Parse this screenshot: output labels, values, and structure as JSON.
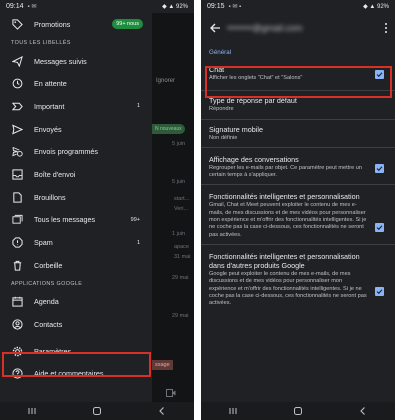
{
  "left": {
    "status": {
      "time": "09:14",
      "right": "92%"
    },
    "drawer": {
      "promotions": {
        "label": "Promotions",
        "badge": "99+ nous"
      },
      "labels_header": "TOUS LES LIBELLÉS",
      "items": [
        {
          "name": "messages-suivis",
          "icon": "send-schedule-icon",
          "label": "Messages suivis",
          "count": ""
        },
        {
          "name": "en-attente",
          "icon": "clock-icon",
          "label": "En attente",
          "count": ""
        },
        {
          "name": "important",
          "icon": "important-icon",
          "label": "Important",
          "count": "1"
        },
        {
          "name": "envoyes",
          "icon": "send-icon",
          "label": "Envoyés",
          "count": ""
        },
        {
          "name": "envois-programmes",
          "icon": "schedule-send-icon",
          "label": "Envois programmés",
          "count": ""
        },
        {
          "name": "boite-envoi",
          "icon": "outbox-icon",
          "label": "Boîte d'envoi",
          "count": ""
        },
        {
          "name": "brouillons",
          "icon": "draft-icon",
          "label": "Brouillons",
          "count": ""
        },
        {
          "name": "tous-les-messages",
          "icon": "all-mail-icon",
          "label": "Tous les messages",
          "count": "99+"
        },
        {
          "name": "spam",
          "icon": "spam-icon",
          "label": "Spam",
          "count": "1"
        },
        {
          "name": "corbeille",
          "icon": "trash-icon",
          "label": "Corbeille",
          "count": ""
        }
      ],
      "apps_header": "APPLICATIONS GOOGLE",
      "apps": [
        {
          "name": "agenda",
          "icon": "calendar-icon",
          "label": "Agenda"
        },
        {
          "name": "contacts",
          "icon": "contacts-icon",
          "label": "Contacts"
        }
      ],
      "settings": {
        "label": "Paramètres"
      },
      "help": {
        "label": "Aide et commentaires"
      }
    },
    "strip": {
      "ignorer": "Ignorer",
      "chip": "N nouveaux",
      "dates": [
        "5 juin",
        "5 juin",
        "start...",
        "Veri...",
        "1 juin",
        "apace",
        "31 mai",
        "29 mai",
        "29 mai"
      ],
      "message_btn": "ssage"
    }
  },
  "right": {
    "status": {
      "time": "09:15",
      "right": "92%"
    },
    "header": {
      "account": "••••••••@gmail.com"
    },
    "general_header": "Général",
    "settings": [
      {
        "name": "chat",
        "title": "Chat",
        "desc": "Afficher les onglets \"Chat\" et \"Salons\"",
        "checked": true
      },
      {
        "name": "type-reponse",
        "title": "Type de réponse par défaut",
        "desc": "Répondre",
        "checked": false
      },
      {
        "name": "signature",
        "title": "Signature mobile",
        "desc": "Non définie",
        "checked": false
      },
      {
        "name": "affichage-conversations",
        "title": "Affichage des conversations",
        "desc": "Regrouper les e-mails par objet. Ce paramètre peut mettre un certain temps à s'appliquer.",
        "checked": true
      },
      {
        "name": "fonctionnalites",
        "title": "Fonctionnalités intelligentes et personnalisation",
        "desc": "Gmail, Chat et Meet peuvent exploiter le contenu de mes e-mails, de mes discussions et de mes vidéos pour personnaliser mon expérience et m'offrir des fonctionnalités intelligentes. Si je ne coche pas la case ci-dessous, ces fonctionnalités ne seront pas activées.",
        "checked": true
      },
      {
        "name": "fonctionnalites-autres",
        "title": "Fonctionnalités intelligentes et personnalisation dans d'autres produits Google",
        "desc": "Google peut exploiter le contenu de mes e-mails, de mes discussions et de mes vidéos pour personnaliser mon expérience et m'offrir des fonctionnalités intelligentes. Si je ne coche pas la case ci-dessous, ces fonctionnalités ne seront pas activées.",
        "checked": true
      }
    ]
  },
  "colors": {
    "background": "#202124",
    "accent": "#8ab4f8",
    "highlight": "#d93025",
    "badge": "#1e8e3e"
  }
}
